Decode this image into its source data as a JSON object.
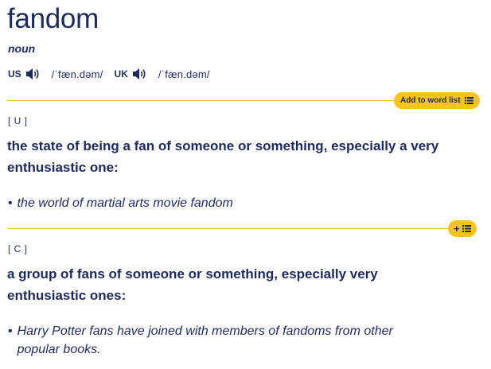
{
  "entry": {
    "headword": "fandom",
    "part_of_speech": "noun",
    "pronunciations": [
      {
        "region": "US",
        "ipa": "/ˈfæn.dəm/",
        "icon": "speaker-icon"
      },
      {
        "region": "UK",
        "ipa": "/ˈfæn.dəm/",
        "icon": "speaker-icon"
      }
    ],
    "add_to_word_list_label": "Add to word list",
    "add_icon": "+",
    "senses": [
      {
        "grammar": "[ U ]",
        "definition": "the state of being a fan of someone or something, especially a very enthusiastic one:",
        "examples": [
          "the world of martial arts movie fandom"
        ]
      },
      {
        "grammar": "[ C ]",
        "definition": "a group of fans of someone or something, especially very enthusiastic ones:",
        "examples": [
          "Harry Potter fans have joined with members of fandoms from other popular books."
        ]
      }
    ]
  },
  "colors": {
    "accent": "#f7c614",
    "text": "#1d2a57",
    "divider": "#f0c31a"
  }
}
